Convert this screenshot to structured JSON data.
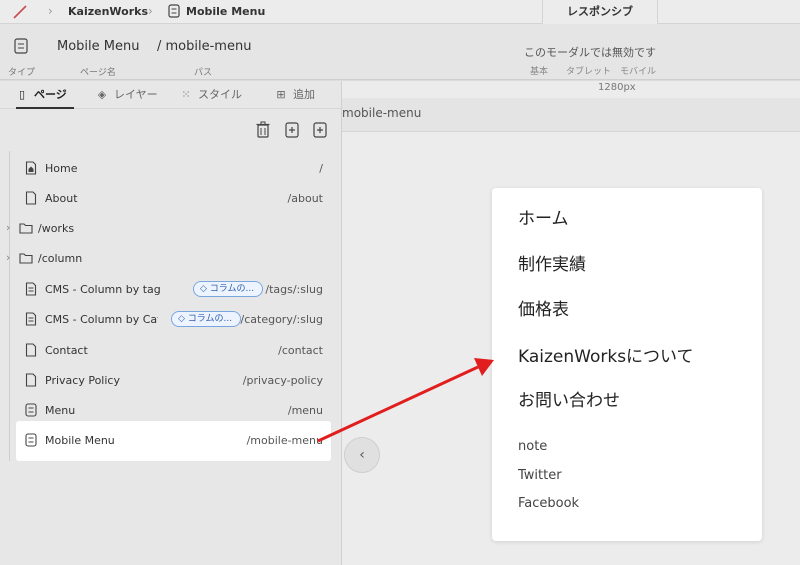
{
  "topbar": {
    "crumbs": [
      "KaizenWorks",
      "Mobile Menu"
    ],
    "responsive_tab": "レスポンシブ"
  },
  "header": {
    "page_name": "Mobile Menu",
    "page_path": "/ mobile-menu",
    "labels": {
      "type": "タイプ",
      "page_name": "ページ名",
      "path": "パス"
    },
    "modal_note": "このモーダルでは無効です",
    "devices": [
      "基本",
      "タブレット",
      "モバイル"
    ]
  },
  "canvas": {
    "width_label": "1280px",
    "path_strip": "mobile-menu",
    "collapse_icon": "‹"
  },
  "panel": {
    "tabs": [
      {
        "label": "ページ",
        "icon": "page-icon"
      },
      {
        "label": "レイヤー",
        "icon": "layers-icon"
      },
      {
        "label": "スタイル",
        "icon": "style-icon"
      },
      {
        "label": "追加",
        "icon": "plus-icon"
      }
    ],
    "rows": [
      {
        "label": "Home",
        "path": "/",
        "icon": "home-page-icon"
      },
      {
        "label": "About",
        "path": "/about",
        "icon": "page-icon"
      },
      {
        "label": "/works",
        "path": "",
        "icon": "folder-icon"
      },
      {
        "label": "/column",
        "path": "",
        "icon": "folder-icon"
      },
      {
        "label": "CMS - Column by tag",
        "path": "/tags/:slug",
        "tag": "コラムの...",
        "icon": "cms-page-icon"
      },
      {
        "label": "CMS - Column by Cate",
        "path": "/category/:slug",
        "tag": "コラムの...",
        "icon": "cms-page-icon"
      },
      {
        "label": "Contact",
        "path": "/contact",
        "icon": "page-icon"
      },
      {
        "label": "Privacy Policy",
        "path": "/privacy-policy",
        "icon": "page-icon"
      },
      {
        "label": "Menu",
        "path": "/menu",
        "icon": "modal-page-icon"
      },
      {
        "label": "Mobile Menu",
        "path": "/mobile-menu",
        "icon": "modal-page-icon"
      }
    ]
  },
  "menu_card": {
    "main_links": [
      "ホーム",
      "制作実績",
      "価格表",
      "KaizenWorksについて",
      "お問い合わせ"
    ],
    "sub_links": [
      "note",
      "Twitter",
      "Facebook"
    ]
  },
  "colors": {
    "arrow": "#e11d1d",
    "tag_border": "#7aa6e0",
    "tag_text": "#2b5fb0"
  }
}
